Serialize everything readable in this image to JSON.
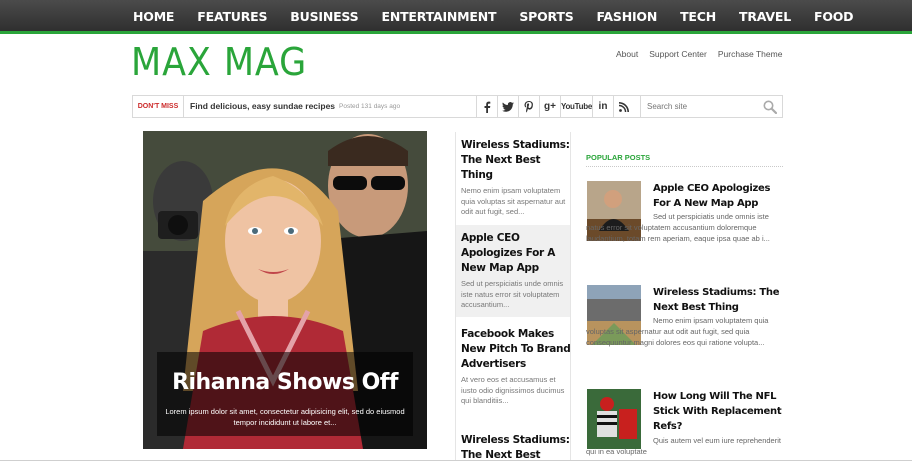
{
  "nav": {
    "items": [
      "HOME",
      "FEATURES",
      "BUSINESS",
      "ENTERTAINMENT",
      "SPORTS",
      "FASHION",
      "TECH",
      "TRAVEL",
      "FOOD"
    ]
  },
  "header": {
    "logo": "MAX MAG",
    "links": [
      "About",
      "Support Center",
      "Purchase Theme"
    ]
  },
  "ticker": {
    "label": "DON'T MISS",
    "headline": "Find delicious, easy sundae recipes",
    "posted": "Posted 131 days ago"
  },
  "social": [
    {
      "icon": "facebook-icon",
      "glyph": "f"
    },
    {
      "icon": "twitter-icon",
      "glyph": "🐦"
    },
    {
      "icon": "pinterest-icon",
      "glyph": "P"
    },
    {
      "icon": "google-plus-icon",
      "glyph": "g+"
    },
    {
      "icon": "youtube-icon",
      "glyph": "YouTube"
    },
    {
      "icon": "linkedin-icon",
      "glyph": "in"
    },
    {
      "icon": "rss-icon",
      "glyph": "⌇"
    }
  ],
  "search": {
    "placeholder": "Search site"
  },
  "featured": {
    "title": "Rihanna Shows Off",
    "excerpt": "Lorem ipsum dolor sit amet, consectetur adipisicing elit, sed do eiusmod tempor incididunt ut labore et..."
  },
  "middle": [
    {
      "title": "Wireless Stadiums: The Next Best Thing",
      "excerpt": "Nemo enim ipsam voluptatem quia voluptas sit aspernatur aut odit aut fugit, sed..."
    },
    {
      "title": "Apple CEO Apologizes For A New Map App",
      "excerpt": "Sed ut perspiciatis unde omnis iste natus error sit voluptatem accusantium..."
    },
    {
      "title": "Facebook Makes New Pitch To Brand Advertisers",
      "excerpt": "At vero eos et accusamus et iusto odio dignissimos ducimus qui blanditiis..."
    },
    {
      "title": "Wireless Stadiums: The Next Best Thing",
      "excerpt": ""
    }
  ],
  "popular": {
    "heading": "POPULAR POSTS",
    "items": [
      {
        "title": "Apple CEO Apologizes For A New Map App",
        "excerpt": "Sed ut perspiciatis unde omnis iste natus error sit voluptatem accusantium doloremque laudantium, totam rem aperiam, eaque ipsa quae ab i..."
      },
      {
        "title": "Wireless Stadiums: The Next Best Thing",
        "excerpt": "Nemo enim ipsam voluptatem quia voluptas sit aspernatur aut odit aut fugit, sed quia consequuntur magni dolores eos qui ratione volupta..."
      },
      {
        "title": "How Long Will The NFL Stick With Replacement Refs?",
        "excerpt": "Quis autem vel eum iure reprehenderit qui in ea voluptate"
      }
    ]
  },
  "colors": {
    "accent": "#2aa53a",
    "dont_miss": "#cc2a2a",
    "nav_bg": "#3a3a3a"
  }
}
